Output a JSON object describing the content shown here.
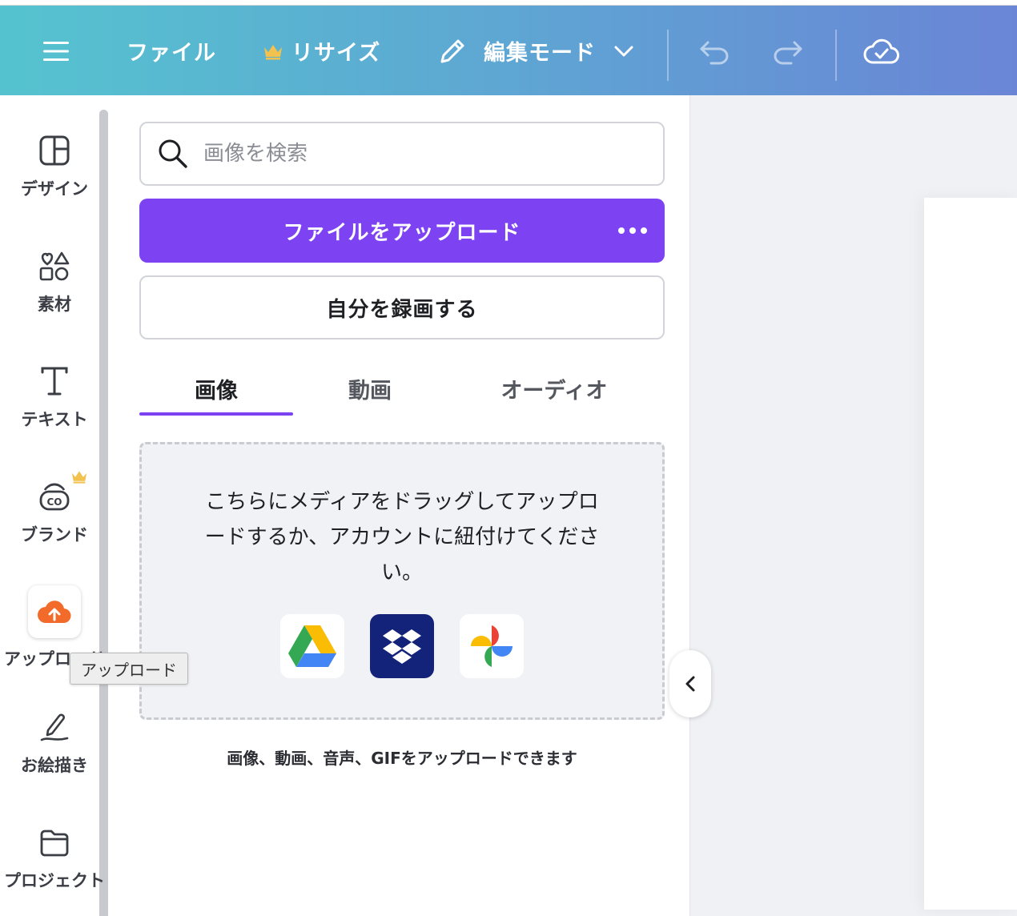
{
  "topbar": {
    "file_label": "ファイル",
    "resize_label": "リサイズ",
    "edit_mode_label": "編集モード",
    "menu_icon": "hamburger-icon",
    "crown_color": "#f2c14e"
  },
  "rail": {
    "items": [
      {
        "label": "デザイン",
        "icon": "layout-icon"
      },
      {
        "label": "素材",
        "icon": "shapes-icon"
      },
      {
        "label": "テキスト",
        "icon": "text-icon"
      },
      {
        "label": "ブランド",
        "icon": "brand-icon"
      },
      {
        "label": "アップロード",
        "icon": "cloud-upload-icon"
      },
      {
        "label": "お絵描き",
        "icon": "pen-draw-icon"
      },
      {
        "label": "プロジェクト",
        "icon": "folder-icon"
      }
    ]
  },
  "tooltip": {
    "text": "アップロード"
  },
  "panel": {
    "search_placeholder": "画像を検索",
    "upload_button": "ファイルをアップロード",
    "record_button": "自分を録画する",
    "tabs": [
      "画像",
      "動画",
      "オーディオ"
    ],
    "active_tab": "画像",
    "dropzone_text": "こちらにメディアをドラッグしてアップロードするか、アカウントに紐付けてください。",
    "services": [
      "google-drive-icon",
      "dropbox-icon",
      "google-photos-icon"
    ],
    "note": "画像、動画、音声、GIFをアップロードできます"
  },
  "colors": {
    "accent": "#7d42f2",
    "upload_orange": "#f26b2b",
    "dropbox_bg": "#13237a"
  }
}
